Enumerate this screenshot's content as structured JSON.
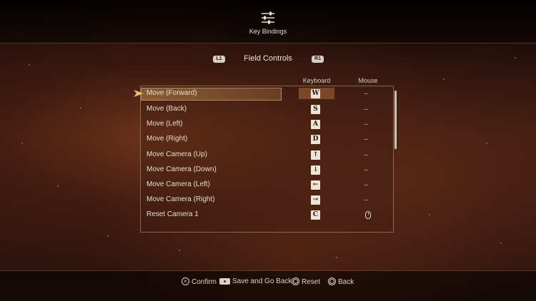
{
  "header": {
    "title": "Key Bindings",
    "icon": "sliders-icon"
  },
  "tabs": {
    "left_shoulder": "L1",
    "right_shoulder": "R1",
    "current": "Field Controls"
  },
  "columns": {
    "keyboard": "Keyboard",
    "mouse": "Mouse"
  },
  "bindings": [
    {
      "action": "Move (Forward)",
      "key": "W",
      "mouse": "--",
      "selected": true
    },
    {
      "action": "Move (Back)",
      "key": "S",
      "mouse": "--"
    },
    {
      "action": "Move (Left)",
      "key": "A",
      "mouse": "--"
    },
    {
      "action": "Move (Right)",
      "key": "D",
      "mouse": "--"
    },
    {
      "action": "Move Camera (Up)",
      "key": "↑",
      "mouse": "--"
    },
    {
      "action": "Move Camera (Down)",
      "key": "↓",
      "mouse": "--"
    },
    {
      "action": "Move Camera (Left)",
      "key": "←",
      "mouse": "--"
    },
    {
      "action": "Move Camera (Right)",
      "key": "→",
      "mouse": "--"
    },
    {
      "action": "Reset Camera 1",
      "key": "C",
      "mouse_icon": "mouse-middle-button-icon"
    }
  ],
  "footer": {
    "confirm": "Confirm",
    "save_back": "Save and Go Back",
    "reset": "Reset",
    "back": "Back"
  },
  "colors": {
    "accent": "#b98a55",
    "panel_border": "#d7bea0",
    "key_bg": "#ece4d6"
  }
}
